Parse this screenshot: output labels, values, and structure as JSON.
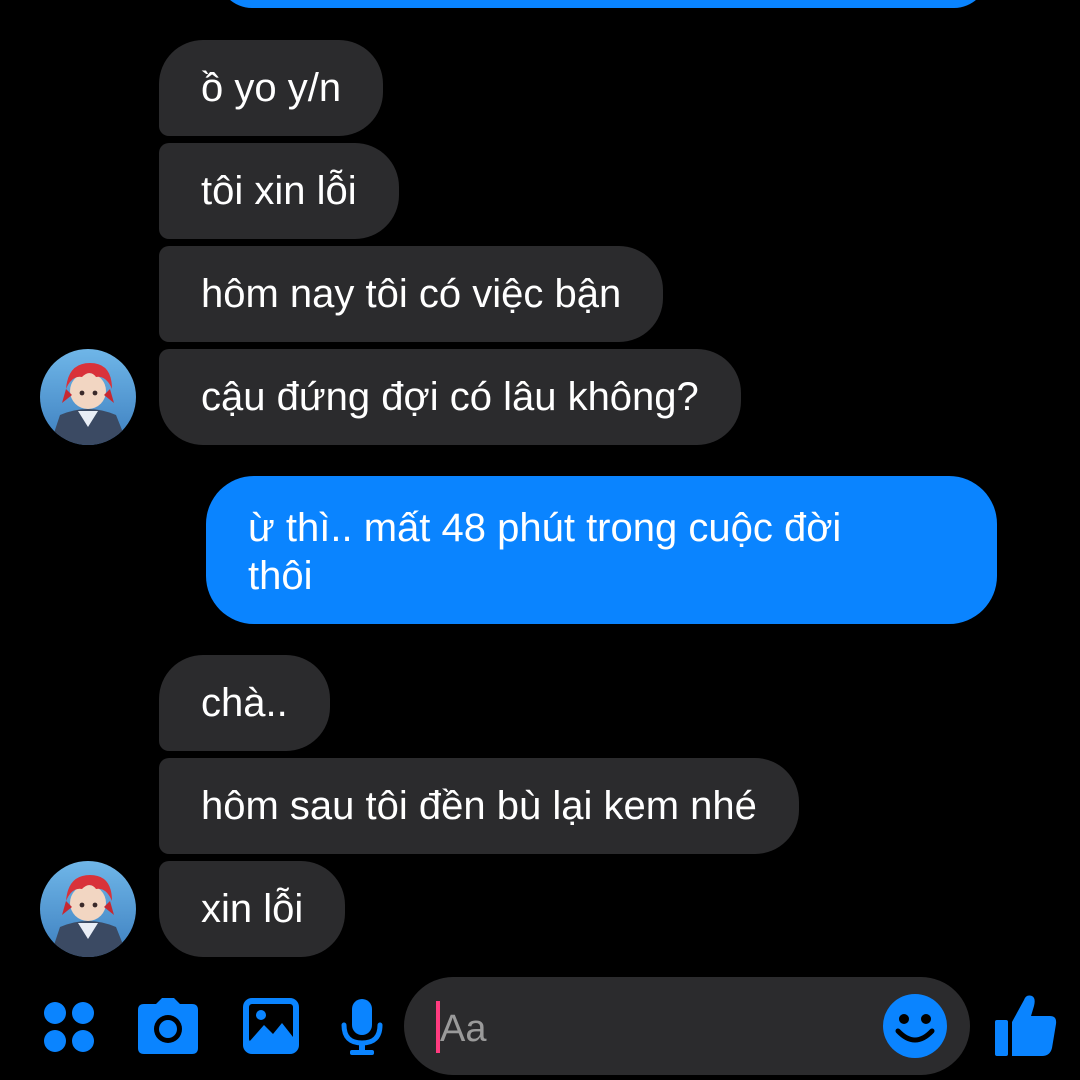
{
  "messages": [
    {
      "text": "ồ yo y/n"
    },
    {
      "text": "tôi xin lỗi"
    },
    {
      "text": "hôm nay tôi có việc bận"
    },
    {
      "text": "cậu đứng đợi có lâu không?"
    },
    {
      "text_line1": "ừ thì.. mất 48 phút trong cuộc đời",
      "text_line2": "thôi"
    },
    {
      "text": "chà.."
    },
    {
      "text": "hôm sau tôi đền bù lại kem nhé"
    },
    {
      "text": "xin lỗi"
    }
  ],
  "composer": {
    "placeholder": "Aa",
    "icons": [
      "apps-icon",
      "camera-icon",
      "gallery-icon",
      "microphone-icon",
      "emoji-icon",
      "thumbs-up-icon"
    ]
  },
  "colors": {
    "background": "#000000",
    "received_bubble": "#2b2b2d",
    "sent_bubble": "#0a84ff",
    "accent": "#0a84ff",
    "caret": "#ff3b7f"
  }
}
